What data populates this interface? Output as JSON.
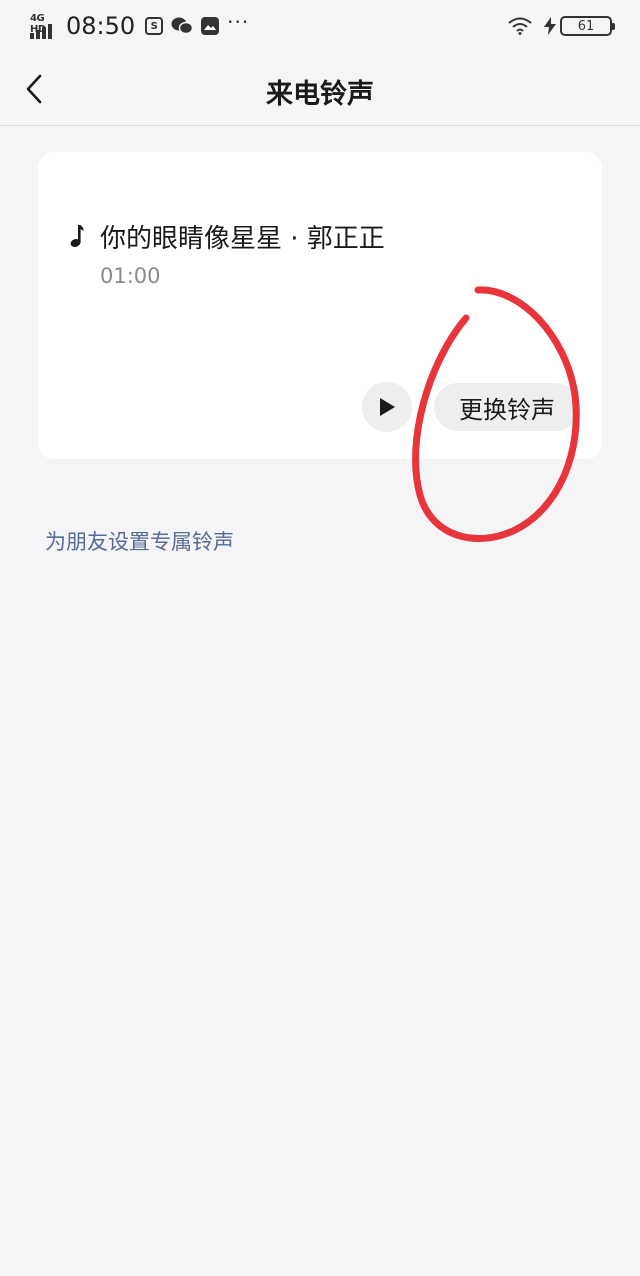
{
  "status_bar": {
    "network": "4G HD",
    "time": "08:50",
    "notification_icons": [
      "S",
      "chat-icon",
      "image-icon"
    ],
    "more": "···",
    "battery": "61"
  },
  "nav": {
    "title": "来电铃声"
  },
  "ringtone": {
    "song": "你的眼睛像星星 · 郭正正",
    "duration": "01:00",
    "change_label": "更换铃声"
  },
  "friend_link": "为朋友设置专属铃声",
  "colors": {
    "background": "#f5f5f7",
    "card": "#ffffff",
    "link": "#576b95",
    "annotation": "#e8353b"
  }
}
